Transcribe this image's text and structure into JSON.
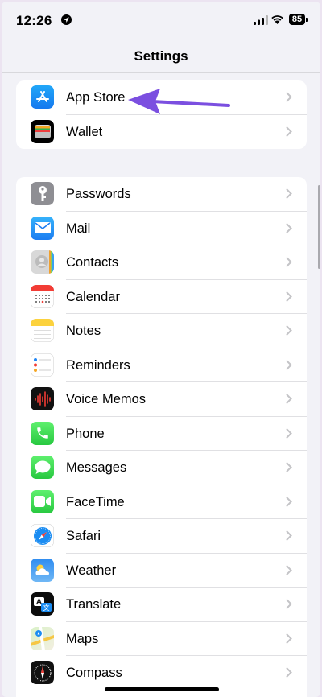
{
  "status_bar": {
    "time": "12:26",
    "battery": "85"
  },
  "title": "Settings",
  "groups": [
    [
      {
        "label": "App Store",
        "icon": "app-store-icon"
      },
      {
        "label": "Wallet",
        "icon": "wallet-icon"
      }
    ],
    [
      {
        "label": "Passwords",
        "icon": "key-icon"
      },
      {
        "label": "Mail",
        "icon": "mail-icon"
      },
      {
        "label": "Contacts",
        "icon": "contacts-icon"
      },
      {
        "label": "Calendar",
        "icon": "calendar-icon"
      },
      {
        "label": "Notes",
        "icon": "notes-icon"
      },
      {
        "label": "Reminders",
        "icon": "reminders-icon"
      },
      {
        "label": "Voice Memos",
        "icon": "voice-memos-icon"
      },
      {
        "label": "Phone",
        "icon": "phone-icon"
      },
      {
        "label": "Messages",
        "icon": "messages-icon"
      },
      {
        "label": "FaceTime",
        "icon": "facetime-icon"
      },
      {
        "label": "Safari",
        "icon": "safari-icon"
      },
      {
        "label": "Weather",
        "icon": "weather-icon"
      },
      {
        "label": "Translate",
        "icon": "translate-icon"
      },
      {
        "label": "Maps",
        "icon": "maps-icon"
      },
      {
        "label": "Compass",
        "icon": "compass-icon"
      }
    ]
  ],
  "annotation": {
    "arrow_color": "#7b4fe0",
    "points_to": "App Store"
  },
  "colors": {
    "background": "#f2f2f7",
    "frame": "#ece4f1",
    "chevron": "#c4c4c7"
  }
}
